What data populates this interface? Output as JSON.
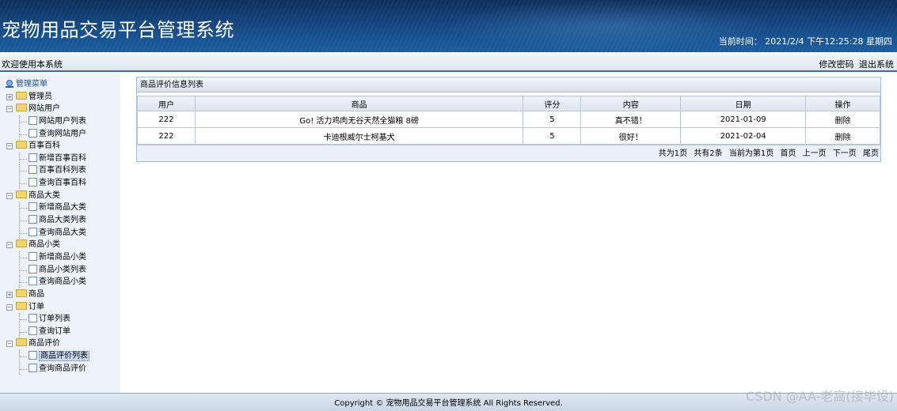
{
  "header": {
    "title": "宠物用品交易平台管理系统",
    "clock": "当前时间： 2021/2/4 下午12:25:28 星期四"
  },
  "topbar": {
    "welcome": "欢迎使用本系统",
    "change_password": "修改密码",
    "logout": "退出系统"
  },
  "sidebar": {
    "root": "管理菜单",
    "groups": [
      {
        "label": "管理员",
        "expanded": false,
        "items": []
      },
      {
        "label": "网站用户",
        "expanded": true,
        "items": [
          "网站用户列表",
          "查询网站用户"
        ]
      },
      {
        "label": "百事百科",
        "expanded": true,
        "items": [
          "新增百事百科",
          "百事百科列表",
          "查询百事百科"
        ]
      },
      {
        "label": "商品大类",
        "expanded": true,
        "items": [
          "新增商品大类",
          "商品大类列表",
          "查询商品大类"
        ]
      },
      {
        "label": "商品小类",
        "expanded": true,
        "items": [
          "新增商品小类",
          "商品小类列表",
          "查询商品小类"
        ]
      },
      {
        "label": "商品",
        "expanded": false,
        "items": []
      },
      {
        "label": "订单",
        "expanded": true,
        "items": [
          "订单列表",
          "查询订单"
        ]
      },
      {
        "label": "商品评价",
        "expanded": true,
        "items": [
          "商品评价列表",
          "查询商品评价"
        ]
      }
    ],
    "selected": "商品评价列表"
  },
  "panel": {
    "title": "商品评价信息列表",
    "columns": [
      "用户",
      "商品",
      "评分",
      "内容",
      "日期",
      "操作"
    ],
    "rows": [
      [
        "222",
        "Go! 活力鸡肉无谷天然全猫粮 8磅",
        "5",
        "真不错！",
        "2021-01-09",
        "删除"
      ],
      [
        "222",
        "卡迪根威尔士柯基犬",
        "5",
        "很好！",
        "2021-02-04",
        "删除"
      ]
    ],
    "pager": {
      "total_pages": "共为1页",
      "total_items": "共有2条",
      "current_page": "当前为第1页",
      "first": "首页",
      "prev": "上一页",
      "next": "下一页",
      "last": "尾页"
    }
  },
  "footer": {
    "copyright": "Copyright © 宠物用品交易平台管理系统 All Rights Reserved.",
    "watermark": "CSDN @AA-老高(接毕设)"
  }
}
